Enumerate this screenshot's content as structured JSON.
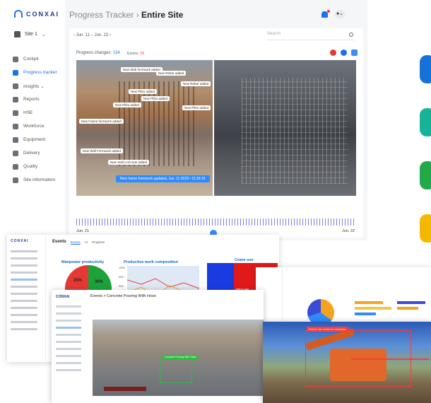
{
  "app": {
    "logo_text": "CONXAI",
    "site": "Site 1",
    "header": {
      "section": "Progress Tracker",
      "separator": "›",
      "page": "Entire Site"
    },
    "nav": [
      {
        "label": "Cockpit",
        "icon": "grid-icon"
      },
      {
        "label": "Progress tracker",
        "icon": "progress-icon",
        "active": true
      },
      {
        "label": "Insights ⌄",
        "icon": "insights-icon"
      },
      {
        "label": "Reports",
        "icon": "reports-icon"
      },
      {
        "label": "HSE",
        "icon": "hse-icon"
      },
      {
        "label": "Workforce",
        "icon": "workforce-icon"
      },
      {
        "label": "Equipment",
        "icon": "equipment-icon"
      },
      {
        "label": "Delivery",
        "icon": "delivery-icon"
      },
      {
        "label": "Quality",
        "icon": "quality-icon"
      },
      {
        "label": "Site information",
        "icon": "site-info-icon"
      }
    ],
    "toolbar": {
      "date_range": "‹ Jun. 11 – Jun. 22 ›",
      "search_placeholder": "Search"
    },
    "stats": {
      "changes_label": "Progress changes:",
      "changes_value": "134",
      "errors_label": "Errors:",
      "errors_value": "15"
    },
    "tags": [
      "New Slab formwork added",
      "New Rebar added",
      "New Rebar added",
      "New Pillar added",
      "New Pillar added",
      "New Pillar added",
      "New Pillar added",
      "New Frame formwork added",
      "New Wall Formwork added",
      "New Wall Concrete added"
    ],
    "tooltip": "New frame formwork updated, Jun. 11 2023 • 11:35:15",
    "timeline": {
      "start": "Jun. 21",
      "end": "Jun. 22"
    },
    "colors": {
      "accent": "#1a73e8",
      "error": "#e53935"
    }
  },
  "events": {
    "logo_text": "CONXAI",
    "title": "Events",
    "tabs": [
      "Events",
      "AI",
      "Progress"
    ],
    "manpower_title": "Manpower productivity",
    "manpower_values": {
      "red": "25%",
      "green": "30%"
    },
    "work_title": "Productive work composition",
    "work_ylabels": [
      "100%",
      "80%",
      "60%",
      "40%",
      "20%"
    ],
    "crane_title": "Crane use",
    "crane_label": "Not in use"
  },
  "pour": {
    "logo_text": "CONXAI",
    "title": "Events > Concrete Pouring With Hose",
    "detection": "Concrete Pouring With Hose"
  },
  "excavator": {
    "detection": "Person too close to excavator"
  }
}
